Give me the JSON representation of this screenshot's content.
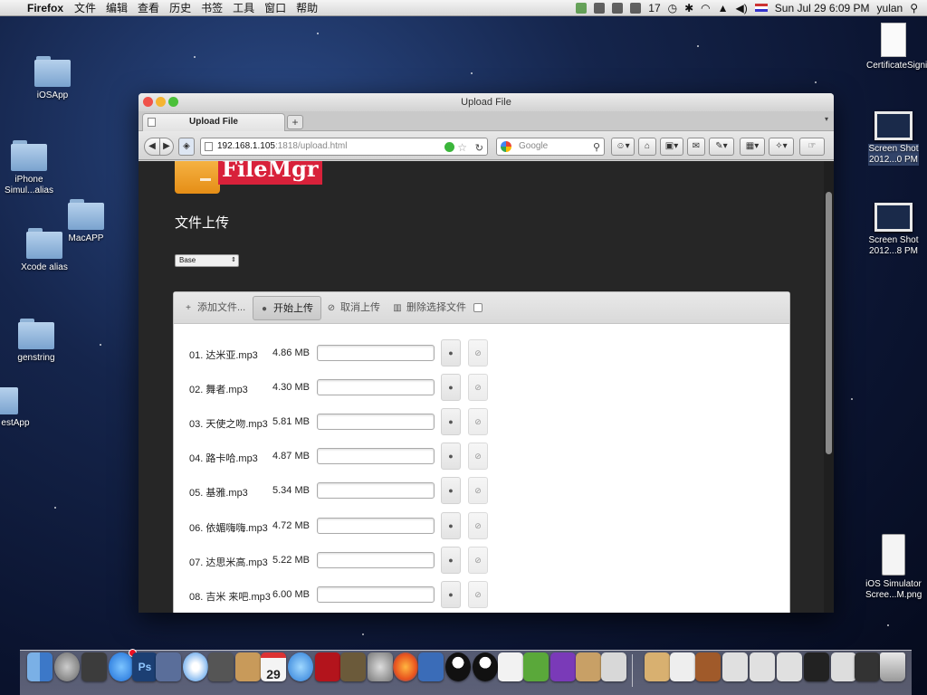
{
  "menubar": {
    "app_name": "Firefox",
    "items": [
      "文件",
      "编辑",
      "查看",
      "历史",
      "书签",
      "工具",
      "窗口",
      "帮助"
    ],
    "status_count": "17",
    "clock": "Sun Jul 29  6:09 PM",
    "user": "yulan"
  },
  "desktop_icons": [
    {
      "label": "iOSApp"
    },
    {
      "label": "iPhone Simul...alias"
    },
    {
      "label": "MacAPP"
    },
    {
      "label": "Xcode alias"
    },
    {
      "label": "genstring"
    },
    {
      "label": "estApp"
    },
    {
      "label": "CertificateSigningR...quest"
    },
    {
      "label": "Screen Shot 2012...0 PM"
    },
    {
      "label": "Screen Shot 2012...8 PM"
    },
    {
      "label": "iOS Simulator Scree...M.png"
    }
  ],
  "window": {
    "title": "Upload File",
    "tab_title": "Upload File",
    "new_tab_glyph": "+",
    "tab_list_glyph": "▾",
    "url_host": "192.168.1.105",
    "url_rest": ":1818/upload.html",
    "search_placeholder": "Google"
  },
  "page": {
    "logo_text": "FileMgr",
    "heading": "文件上传",
    "select_value": "Base",
    "toolbar": {
      "add_files": "添加文件...",
      "start_upload": "开始上传",
      "cancel_upload": "取消上传",
      "delete_selected": "删除选择文件"
    },
    "files": [
      {
        "name": "01. 达米亚.mp3",
        "size": "4.86 MB"
      },
      {
        "name": "02. 舞者.mp3",
        "size": "4.30 MB"
      },
      {
        "name": "03. 天使之吻.mp3",
        "size": "5.81 MB"
      },
      {
        "name": "04. 路卡哈.mp3",
        "size": "4.87 MB"
      },
      {
        "name": "05. 基雅.mp3",
        "size": "5.34 MB"
      },
      {
        "name": "06. 依媚嗨嗨.mp3",
        "size": "4.72 MB"
      },
      {
        "name": "07. 达思米高.mp3",
        "size": "5.22 MB"
      },
      {
        "name": "08. 吉米 来吧.mp3",
        "size": "6.00 MB"
      }
    ]
  },
  "dock": {
    "calendar_day": "29"
  },
  "colors": {
    "accent_red": "#d8213a",
    "folder_orange": "#f0a028",
    "page_bg": "#262626"
  }
}
